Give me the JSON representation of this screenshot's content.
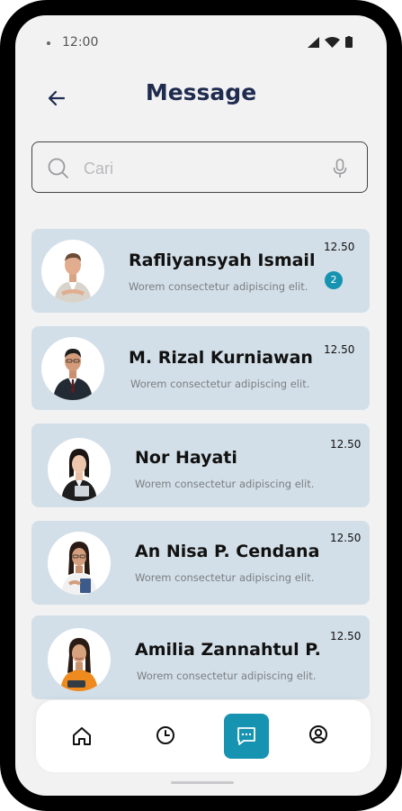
{
  "status_bar": {
    "time": "12:00"
  },
  "header": {
    "title": "Message"
  },
  "search": {
    "placeholder": "Cari"
  },
  "messages": [
    {
      "name": "Rafliyansyah Ismail",
      "preview": "Worem consectetur adipiscing elit.",
      "time": "12.50",
      "unread": "2"
    },
    {
      "name": "M. Rizal Kurniawan",
      "preview": "Worem consectetur adipiscing elit.",
      "time": "12.50"
    },
    {
      "name": "Nor Hayati",
      "preview": "Worem consectetur adipiscing elit.",
      "time": "12.50"
    },
    {
      "name": "An Nisa P. Cendana",
      "preview": "Worem consectetur adipiscing elit.",
      "time": "12.50"
    },
    {
      "name": "Amilia Zannahtul P.",
      "preview": "Worem consectetur adipiscing elit.",
      "time": "12.50"
    }
  ],
  "bottom_nav": {
    "items": [
      {
        "icon": "home-icon",
        "active": false
      },
      {
        "icon": "clock-icon",
        "active": false
      },
      {
        "icon": "chat-icon",
        "active": true
      },
      {
        "icon": "profile-icon",
        "active": false
      }
    ]
  },
  "colors": {
    "accent": "#1693b0",
    "card": "#d3dfe8",
    "title": "#1f2c4f"
  }
}
